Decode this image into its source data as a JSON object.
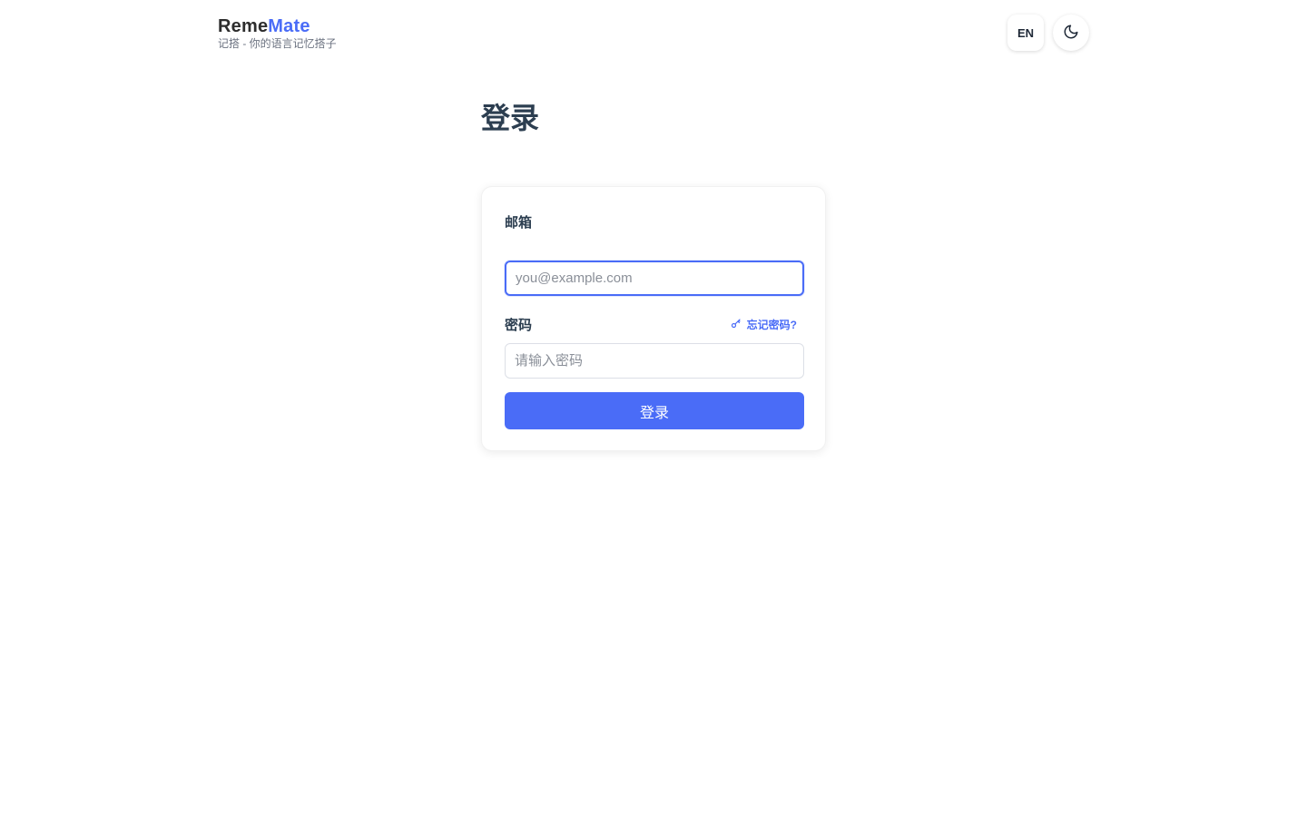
{
  "header": {
    "brand_part1": "Reme",
    "brand_part2": "Mate",
    "tagline": "记搭 - 你的语言记忆搭子",
    "lang_label": "EN",
    "theme_icon": "moon-icon"
  },
  "main": {
    "title": "登录"
  },
  "form": {
    "email_label": "邮箱",
    "email_placeholder": "you@example.com",
    "email_value": "",
    "password_label": "密码",
    "password_placeholder": "请输入密码",
    "password_value": "",
    "forgot_label": "忘记密码?",
    "forgot_icon": "key-icon",
    "submit_label": "登录"
  },
  "colors": {
    "accent": "#4a6cf7",
    "title": "#2c3e50"
  }
}
